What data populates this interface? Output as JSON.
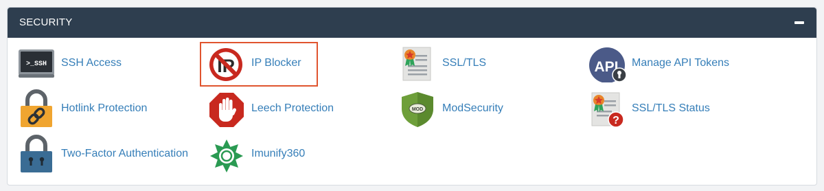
{
  "panel": {
    "title": "SECURITY",
    "collapse_icon": "minus-icon",
    "header_color": "#2e3e4f",
    "link_color": "#357eb8",
    "highlight_color": "#e0542e"
  },
  "items": [
    {
      "label": "SSH Access",
      "icon": "terminal-icon"
    },
    {
      "label": "IP Blocker",
      "icon": "ip-blocker-icon",
      "highlighted": true
    },
    {
      "label": "SSL/TLS",
      "icon": "certificate-icon"
    },
    {
      "label": "Manage API Tokens",
      "icon": "api-token-icon"
    },
    {
      "label": "Hotlink Protection",
      "icon": "lock-link-icon"
    },
    {
      "label": "Leech Protection",
      "icon": "stop-hand-icon"
    },
    {
      "label": "ModSecurity",
      "icon": "mod-shield-icon"
    },
    {
      "label": "SSL/TLS Status",
      "icon": "certificate-status-icon"
    },
    {
      "label": "Two-Factor Authentication",
      "icon": "two-factor-lock-icon"
    },
    {
      "label": "Imunify360",
      "icon": "imunify-icon"
    }
  ]
}
